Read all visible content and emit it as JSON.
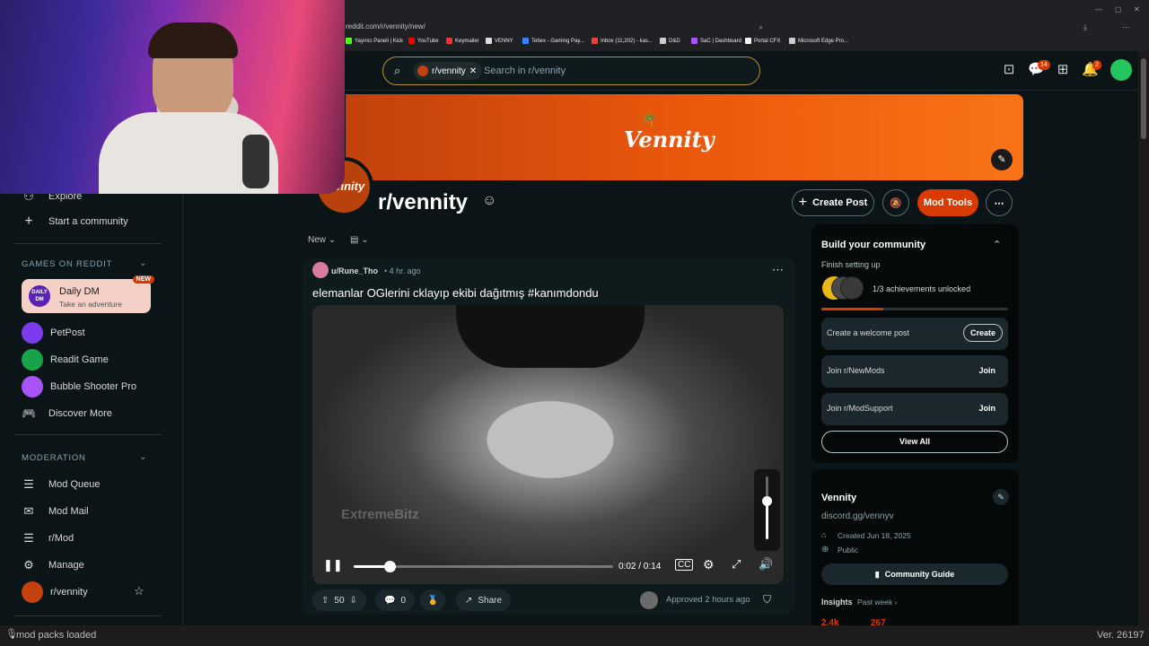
{
  "browser": {
    "url": "reddit.com/r/vennity/new/",
    "bookmarks": [
      {
        "label": "Yayıncı Paneli | Kick",
        "color": "#53fc18"
      },
      {
        "label": "YouTube",
        "color": "#ff0000"
      },
      {
        "label": "Keymailer",
        "color": "#e33"
      },
      {
        "label": "VENNY",
        "color": "#ddd"
      },
      {
        "label": "Tebex - Gaming Pay...",
        "color": "#3b82f6"
      },
      {
        "label": "Inbox (11,202) - kas...",
        "color": "#ea4335"
      },
      {
        "label": "D&D",
        "color": "#ccc"
      },
      {
        "label": "SaC | Dashboard",
        "color": "#a855f7"
      },
      {
        "label": "Portal CFX",
        "color": "#f4f4f4"
      },
      {
        "label": "Microsoft Edge Pro...",
        "color": "#ccc"
      }
    ]
  },
  "header": {
    "search_chip": "r/vennity",
    "search_placeholder": "Search in r/vennity",
    "chat_badge": "14",
    "notif_badge": "2"
  },
  "sidebar": {
    "top_items": [
      {
        "label": "Explore",
        "icon": "explore-icon"
      },
      {
        "label": "Start a community",
        "icon": "plus-icon"
      }
    ],
    "games_heading": "GAMES ON REDDIT",
    "daily_dm": {
      "title": "Daily DM",
      "subtitle": "Take an adventure",
      "badge": "NEW",
      "icon_text": "DAILY DM"
    },
    "games": [
      {
        "label": "PetPost",
        "color": "#7c3aed"
      },
      {
        "label": "Readit Game",
        "color": "#16a34a"
      },
      {
        "label": "Bubble Shooter Pro",
        "color": "#a855f7"
      },
      {
        "label": "Discover More",
        "color": ""
      }
    ],
    "moderation_heading": "MODERATION",
    "mod_items": [
      {
        "label": "Mod Queue",
        "icon": "mod-queue-icon"
      },
      {
        "label": "Mod Mail",
        "icon": "mail-icon"
      },
      {
        "label": "r/Mod",
        "icon": "mod-icon"
      },
      {
        "label": "Manage",
        "icon": "gear-icon"
      },
      {
        "label": "r/vennity",
        "icon": "vennity-avatar"
      }
    ]
  },
  "community": {
    "banner_logo": "Vennity",
    "avatar_text": "Vennity",
    "name": "r/vennity",
    "create_post": "Create Post",
    "mod_tools": "Mod Tools"
  },
  "feed": {
    "sort": "New",
    "post": {
      "author": "u/Rune_Tho",
      "time": "• 4 hr. ago",
      "title": "elemanlar OGlerini cklayıp ekibi dağıtmış #kanımdondu",
      "watermark": "ExtremeBitz",
      "time_display": "0:02 / 0:14",
      "progress": 0.14,
      "volume": 0.6,
      "votes": "50",
      "comments": "0",
      "share": "Share",
      "approved": "Approved 2 hours ago"
    }
  },
  "build_community": {
    "title": "Build your community",
    "subtitle": "Finish setting up",
    "achievements": "1/3 achievements unlocked",
    "progress": 0.33,
    "tasks": [
      {
        "label": "Create a welcome post",
        "action": "Create"
      },
      {
        "label": "Join r/NewMods",
        "action": "Join"
      },
      {
        "label": "Join r/ModSupport",
        "action": "Join"
      }
    ],
    "view_all": "View All"
  },
  "about": {
    "name": "Vennity",
    "link": "discord.gg/vennyv",
    "created": "Created Jun 18, 2025",
    "visibility": "Public",
    "guide": "Community Guide",
    "insights": "Insights",
    "insights_period": "Past week ›",
    "stat1": "2.4k",
    "stat2": "267"
  },
  "statusbar": {
    "left": "mod packs loaded",
    "right": "Ver. 26197"
  },
  "colors": {
    "accent_orange": "#d93a00",
    "banner": "#ea580c",
    "bg": "#0b1416"
  }
}
